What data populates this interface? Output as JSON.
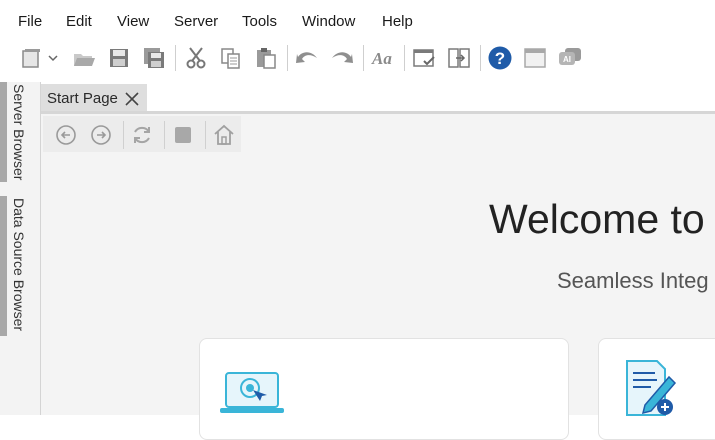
{
  "menu": [
    "File",
    "Edit",
    "View",
    "Server",
    "Tools",
    "Window",
    "Help"
  ],
  "toolbar_icons": [
    "new-document-icon",
    "dropdown-arrow-icon",
    "open-folder-icon",
    "save-icon",
    "save-all-icon",
    "cut-icon",
    "copy-icon",
    "paste-icon",
    "undo-icon",
    "redo-icon",
    "font-icon",
    "check-window-icon",
    "compare-icon",
    "help-icon",
    "window-icon",
    "ai-chat-icon"
  ],
  "side_panel": {
    "server_browser": "Server Browser",
    "data_source_browser": "Data Source Browser"
  },
  "tab": {
    "label": "Start Page"
  },
  "start_page": {
    "welcome": "Welcome to",
    "subtitle": "Seamless Integ"
  },
  "colors": {
    "help_blue": "#1f5ba8",
    "accent_cyan": "#3ab5d8",
    "icon_gray": "#777777"
  }
}
